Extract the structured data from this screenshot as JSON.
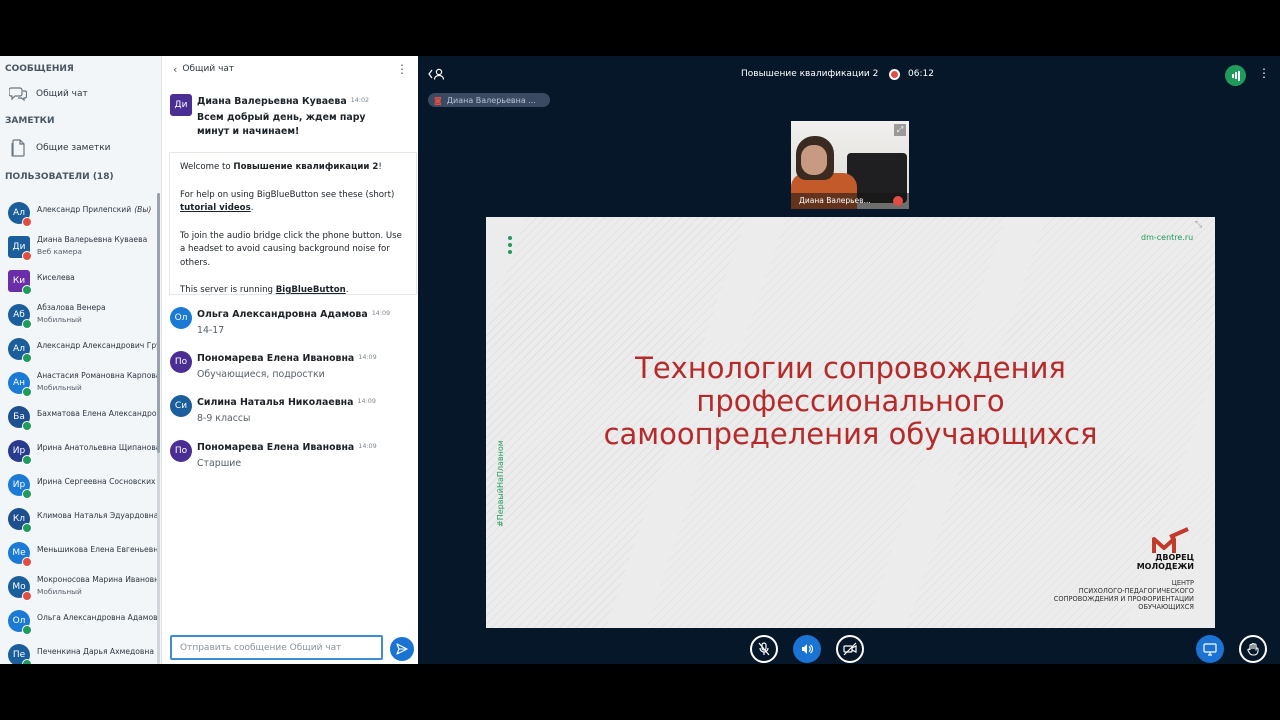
{
  "sidebar": {
    "messages_heading": "СООБЩЕНИЯ",
    "public_chat": "Общий чат",
    "notes_heading": "ЗАМЕТКИ",
    "shared_notes": "Общие заметки",
    "users_heading": "ПОЛЬЗОВАТЕЛИ (18)"
  },
  "users": [
    {
      "initials": "Ал",
      "name": "Александр Прилепский",
      "suffix": "(Вы)",
      "sub": "",
      "color": "#1b5e9c",
      "badge": "mute",
      "shape": "circle"
    },
    {
      "initials": "Ди",
      "name": "Диана Валерьевна Куваева",
      "suffix": "",
      "sub": "Веб камера",
      "color": "#1b5e9c",
      "badge": "mute",
      "shape": "square"
    },
    {
      "initials": "Ки",
      "name": "Киселева",
      "suffix": "",
      "sub": "",
      "color": "#6a2fa8",
      "badge": "mic",
      "shape": "square"
    },
    {
      "initials": "Аб",
      "name": "Абзалова Венера",
      "suffix": "",
      "sub": "Мобильный",
      "color": "#1b5e9c",
      "badge": "mic",
      "shape": "circle"
    },
    {
      "initials": "Ал",
      "name": "Александр Александрович Гру...",
      "suffix": "",
      "sub": "",
      "color": "#1b5e9c",
      "badge": "mic",
      "shape": "circle"
    },
    {
      "initials": "Ан",
      "name": "Анастасия Романовна Карпова",
      "suffix": "",
      "sub": "Мобильный",
      "color": "#1b7ad6",
      "badge": "mic",
      "shape": "circle"
    },
    {
      "initials": "Ба",
      "name": "Бахматова Елена Александро...",
      "suffix": "",
      "sub": "",
      "color": "#1e4f8f",
      "badge": "mic",
      "shape": "circle"
    },
    {
      "initials": "Ир",
      "name": "Ирина Анатольевна Щипанова",
      "suffix": "",
      "sub": "",
      "color": "#283b8f",
      "badge": "mic",
      "shape": "circle"
    },
    {
      "initials": "Ир",
      "name": "Ирина Сергеевна Сосновских",
      "suffix": "",
      "sub": "",
      "color": "#1b7ad6",
      "badge": "mic",
      "shape": "circle"
    },
    {
      "initials": "Кл",
      "name": "Климова Наталья Эдуардовна",
      "suffix": "",
      "sub": "",
      "color": "#1e4f8f",
      "badge": "mic",
      "shape": "circle"
    },
    {
      "initials": "Ме",
      "name": "Меньшикова Елена Евгеньевна",
      "suffix": "",
      "sub": "",
      "color": "#1b7ad6",
      "badge": "mute",
      "shape": "circle"
    },
    {
      "initials": "Мо",
      "name": "Мокроносова Марина Ивановна",
      "suffix": "",
      "sub": "Мобильный",
      "color": "#1b5e9c",
      "badge": "mute",
      "shape": "circle"
    },
    {
      "initials": "Ол",
      "name": "Ольга Александровна Адамова",
      "suffix": "",
      "sub": "",
      "color": "#1b7ad6",
      "badge": "mic",
      "shape": "circle"
    },
    {
      "initials": "Пе",
      "name": "Печенкина Дарья Ахмедовна",
      "suffix": "",
      "sub": "",
      "color": "#1b5e9c",
      "badge": "mic",
      "shape": "circle"
    }
  ],
  "chat": {
    "title": "Общий чат",
    "welcome_prefix": "Welcome to ",
    "welcome_name": "Повышение квалификации 2",
    "welcome_suffix": "!",
    "help_text": "For help on using BigBlueButton see these (short) ",
    "help_link": "tutorial videos",
    "help_end": ".",
    "audio_text": "To join the audio bridge click the phone button. Use a headset to avoid causing background noise for others.",
    "server_text": "This server is running ",
    "server_link": "BigBlueButton",
    "server_end": ".",
    "composer_placeholder": "Отправить сообщение Общий чат",
    "messages": [
      {
        "initials": "Ди",
        "author": "Диана Валерьевна Куваева",
        "time": "14:02",
        "text": "Всем добрый день, ждем пару минут и начинаем!",
        "color": "#4b2e93"
      },
      {
        "initials": "Ол",
        "author": "Ольга Александровна Адамова",
        "time": "14:09",
        "text": "14-17",
        "color": "#1b7ad6"
      },
      {
        "initials": "По",
        "author": "Пономарева Елена Ивановна",
        "time": "14:09",
        "text": "Обучающиеся, подростки",
        "color": "#4b2e93"
      },
      {
        "initials": "Си",
        "author": "Силина Наталья Николаевна",
        "time": "14:09",
        "text": "8-9 классы",
        "color": "#1b5e9c"
      },
      {
        "initials": "По",
        "author": "Пономарева Елена Ивановна",
        "time": "14:09",
        "text": "Старшие",
        "color": "#4b2e93"
      }
    ]
  },
  "stage": {
    "meeting_title": "Повышение квалификации 2",
    "record_time": "06:12",
    "talker": "Диана Валерьевна ...",
    "webcam_name": "Диана Валерьев..."
  },
  "slide": {
    "site": "dm-centre.ru",
    "title_line1": "Технологии сопровождения",
    "title_line2": "профессионального",
    "title_line3": "самоопределения обучающихся",
    "hashtag": "#ПервыйНаПлавном",
    "org_line1": "ДВОРЕЦ",
    "org_line2": "МОЛОДЕЖИ",
    "org_sub1": "ЦЕНТР",
    "org_sub2": "ПСИХОЛОГО-ПЕДАГОГИЧЕСКОГО",
    "org_sub3": "СОПРОВОЖДЕНИЯ И ПРОФОРИЕНТАЦИИ",
    "org_sub4": "ОБУЧАЮЩИХСЯ",
    "title_color": "#b62a2a",
    "accent_color": "#1f9c5b"
  },
  "icons": {
    "chat": "chat-icon",
    "notes": "notes-icon",
    "mic_off": "mic-off-icon",
    "audio": "audio-icon",
    "video_off": "video-off-icon",
    "screen": "desktop-icon",
    "raise_hand": "hand-icon"
  }
}
